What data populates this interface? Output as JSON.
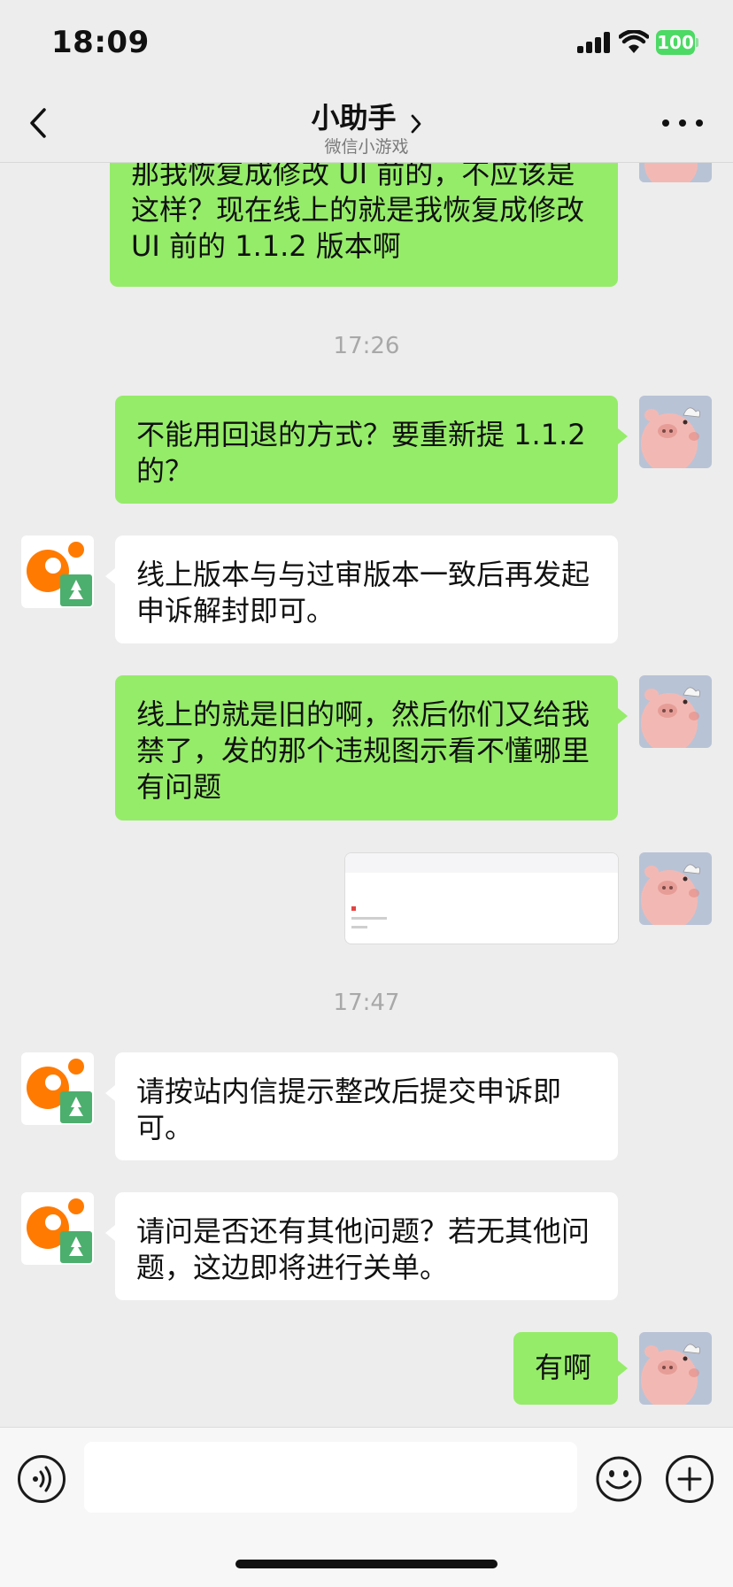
{
  "status_bar": {
    "time": "18:09",
    "battery": "100"
  },
  "nav": {
    "title": "小助手",
    "subtitle": "微信小游戏"
  },
  "messages": [
    {
      "from": "me",
      "text": "那我恢复成修改 UI 前的，不应该是这样？现在线上的就是我恢复成修改 UI 前的 1.1.2 版本啊"
    },
    {
      "type": "timestamp",
      "text": "17:26"
    },
    {
      "from": "me",
      "text": "不能用回退的方式？要重新提 1.1.2 的？"
    },
    {
      "from": "assistant",
      "text": "线上版本与与过审版本一致后再发起申诉解封即可。"
    },
    {
      "from": "me",
      "text": "线上的就是旧的啊，然后你们又给我禁了，发的那个违规图示看不懂哪里有问题"
    },
    {
      "from": "me",
      "type": "image"
    },
    {
      "type": "timestamp",
      "text": "17:47"
    },
    {
      "from": "assistant",
      "text": "请按站内信提示整改后提交申诉即可。"
    },
    {
      "from": "assistant",
      "text": "请问是否还有其他问题？若无其他问题，这边即将进行关单。"
    },
    {
      "from": "me",
      "text": "有啊"
    }
  ],
  "colors": {
    "my_bubble": "#95ec69",
    "their_bubble": "#ffffff",
    "background": "#ededed",
    "bot_orange": "#ff7a00"
  },
  "icons": {
    "back": "back-chevron-icon",
    "more": "more-dots-icon",
    "voice": "voice-icon",
    "emoji": "emoji-icon",
    "plus": "plus-icon"
  }
}
